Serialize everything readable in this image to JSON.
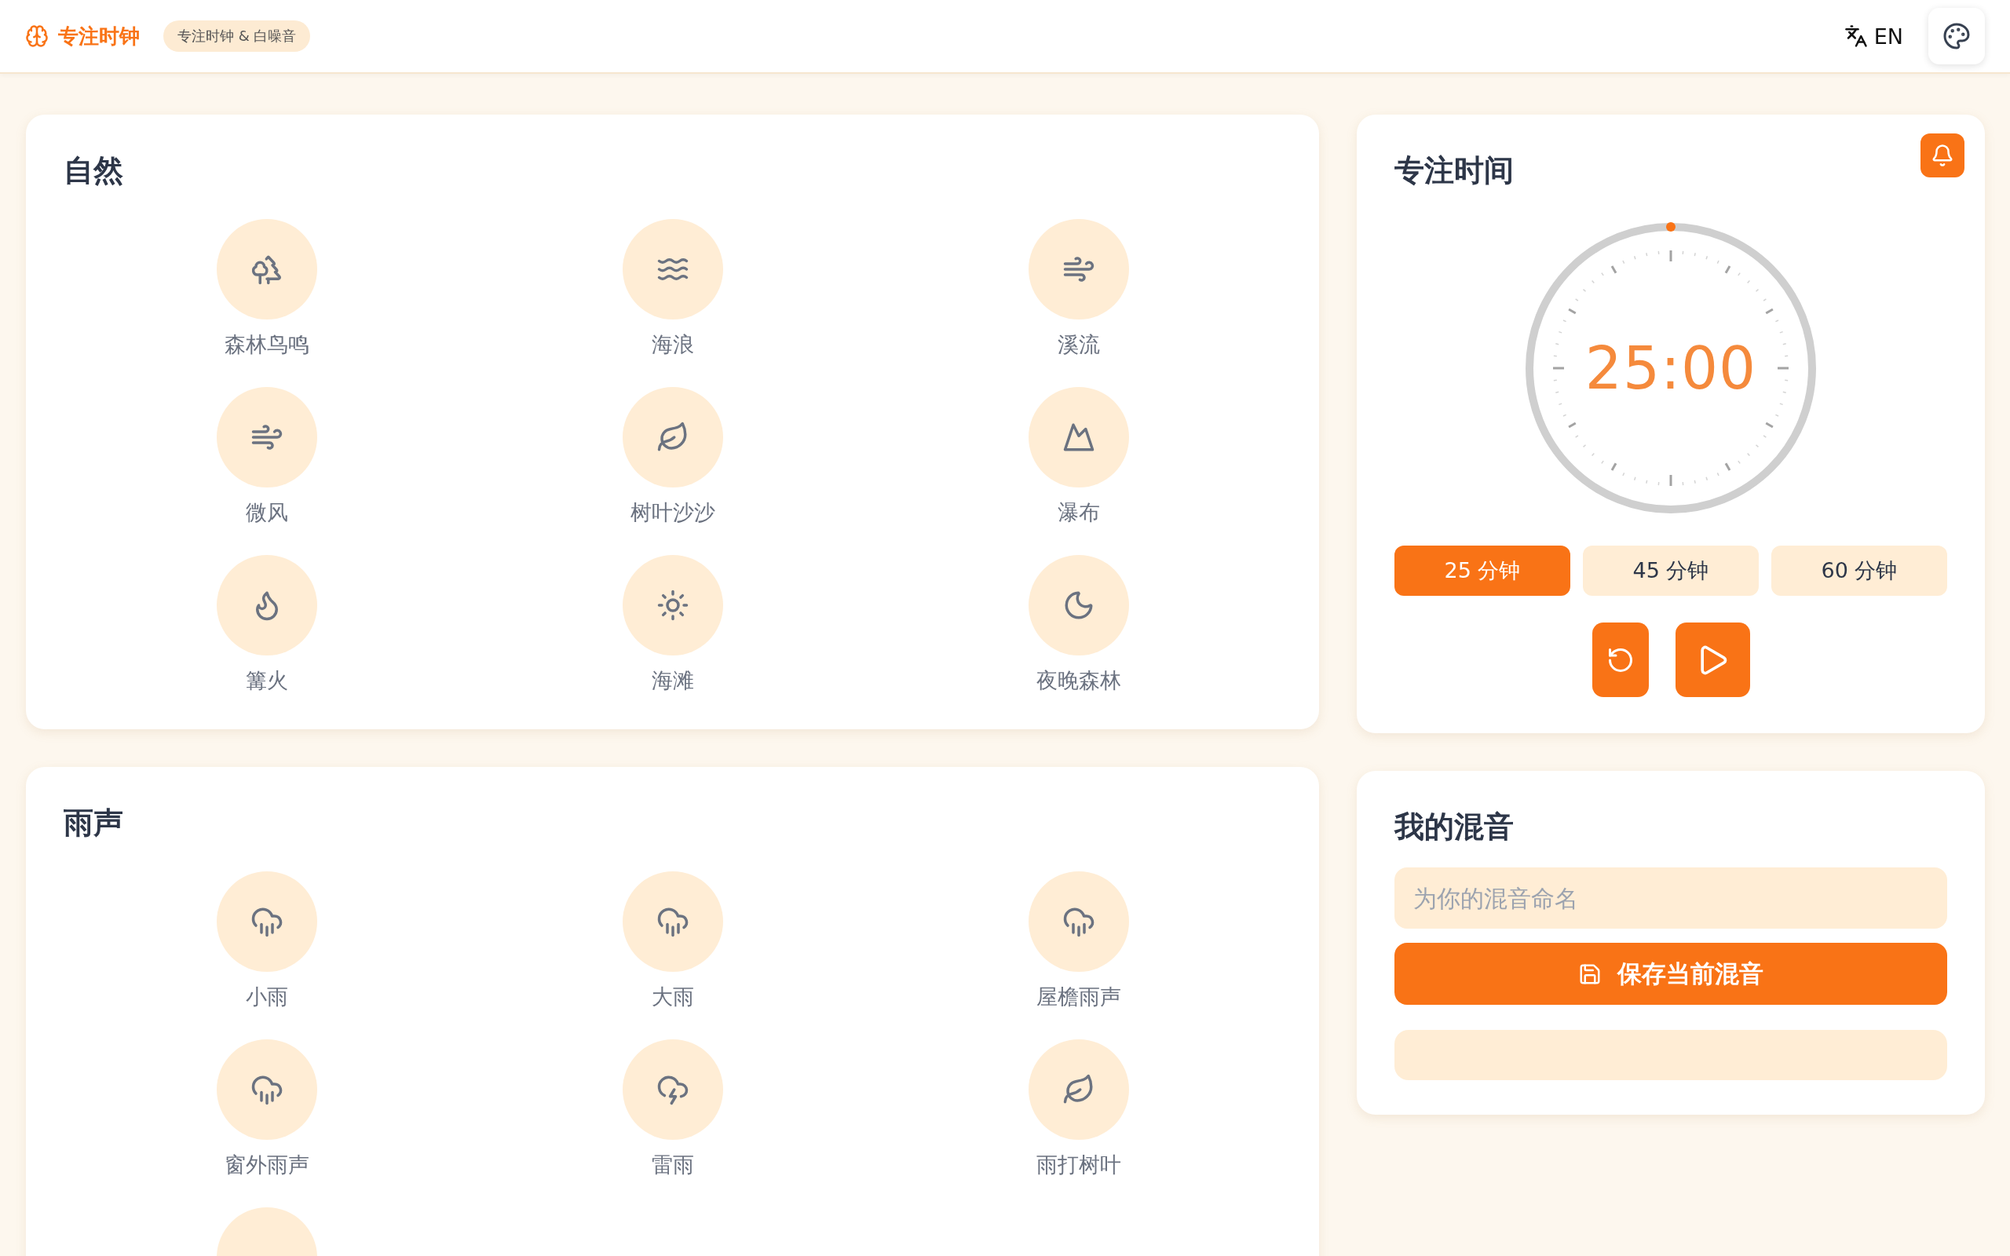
{
  "header": {
    "app_name": "专注时钟",
    "badge": "专注时钟 & 白噪音",
    "language": "EN"
  },
  "sections": [
    {
      "title": "自然",
      "items": [
        {
          "kind": "trees",
          "label": "森林鸟鸣"
        },
        {
          "kind": "waves",
          "label": "海浪"
        },
        {
          "kind": "wind",
          "label": "溪流"
        },
        {
          "kind": "wind",
          "label": "微风"
        },
        {
          "kind": "leaf",
          "label": "树叶沙沙"
        },
        {
          "kind": "mountain",
          "label": "瀑布"
        },
        {
          "kind": "flame",
          "label": "篝火"
        },
        {
          "kind": "sun",
          "label": "海滩"
        },
        {
          "kind": "moon",
          "label": "夜晚森林"
        }
      ]
    },
    {
      "title": "雨声",
      "items": [
        {
          "kind": "rain",
          "label": "小雨"
        },
        {
          "kind": "rain",
          "label": "大雨"
        },
        {
          "kind": "rain",
          "label": "屋檐雨声"
        },
        {
          "kind": "rain",
          "label": "窗外雨声"
        },
        {
          "kind": "storm",
          "label": "雷雨"
        },
        {
          "kind": "leaf",
          "label": "雨打树叶"
        },
        {
          "kind": "partial"
        }
      ]
    }
  ],
  "timer": {
    "title": "专注时间",
    "time": "25:00",
    "durations": [
      {
        "label": "25 分钟",
        "selected": true
      },
      {
        "label": "45 分钟",
        "selected": false
      },
      {
        "label": "60 分钟",
        "selected": false
      }
    ]
  },
  "mix": {
    "title": "我的混音",
    "placeholder": "为你的混音命名",
    "save_label": "保存当前混音"
  }
}
